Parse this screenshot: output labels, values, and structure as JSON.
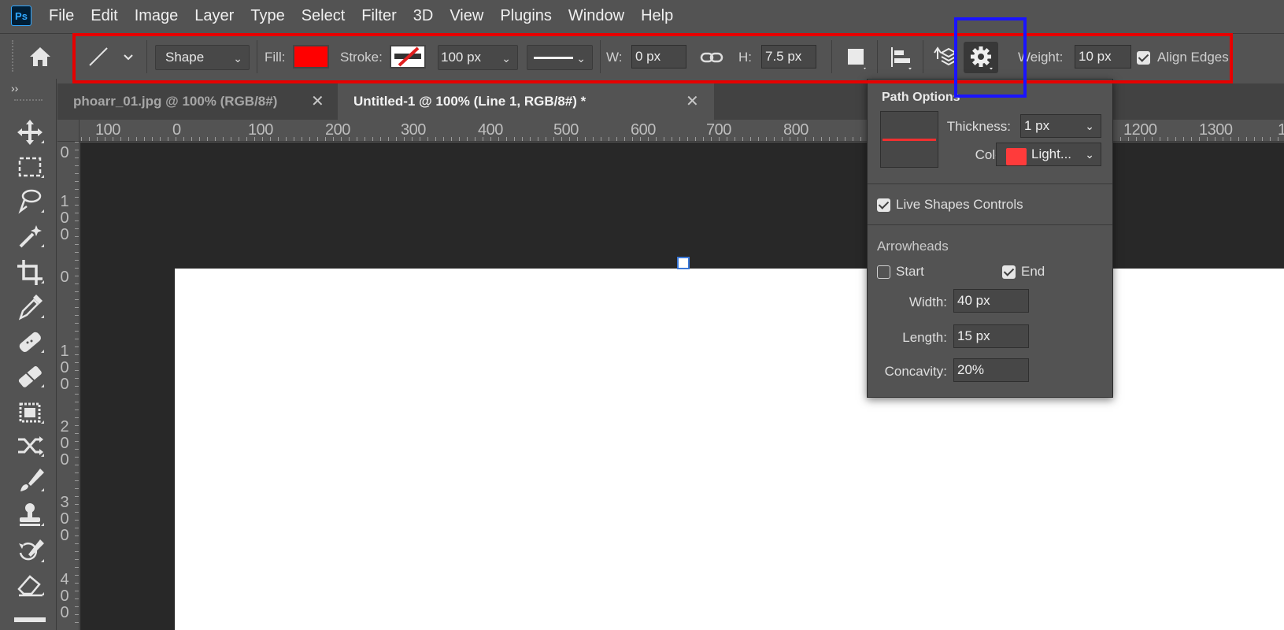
{
  "app": {
    "logo": "Ps",
    "menu": [
      "File",
      "Edit",
      "Image",
      "Layer",
      "Type",
      "Select",
      "Filter",
      "3D",
      "View",
      "Plugins",
      "Window",
      "Help"
    ]
  },
  "options": {
    "mode": "Shape",
    "fill_label": "Fill:",
    "fill_color": "#ff0000",
    "stroke_label": "Stroke:",
    "stroke_width": "100 px",
    "w_label": "W:",
    "w_value": "0 px",
    "h_label": "H:",
    "h_value": "7.5 px",
    "weight_label": "Weight:",
    "weight_value": "10 px",
    "align_edges_label": "Align Edges",
    "align_edges_checked": true,
    "icons": [
      "home-icon",
      "line-tool-icon",
      "link-icon",
      "path-operations-icon",
      "path-alignment-icon",
      "path-arrangement-icon",
      "gear-icon"
    ]
  },
  "annotations": {
    "options_highlight_color": "#e60000",
    "gear_highlight_color": "#1a14ff"
  },
  "tools": [
    "move-tool-icon",
    "marquee-tool-icon",
    "lasso-tool-icon",
    "magic-wand-tool-icon",
    "crop-tool-icon",
    "eyedropper-tool-icon",
    "spot-healing-tool-icon",
    "bandage-tool-icon",
    "content-aware-move-icon",
    "shuffle-tool-icon",
    "brush-tool-icon",
    "clone-stamp-tool-icon",
    "history-brush-tool-icon",
    "eraser-tool-icon"
  ],
  "tabs": [
    {
      "label": "phoarr_01.jpg @ 100% (RGB/8#)",
      "active": false
    },
    {
      "label": "Untitled-1 @ 100% (Line 1, RGB/8#) *",
      "active": true
    }
  ],
  "ruler": {
    "h_ticks": [
      "100",
      "0",
      "100",
      "200",
      "300",
      "400",
      "500",
      "600",
      "700",
      "800",
      "1200",
      "1300",
      "1"
    ],
    "v_ticks": [
      "0",
      "100",
      "0",
      "100",
      "200",
      "300",
      "400"
    ]
  },
  "path_options": {
    "title": "Path Options",
    "thickness_label": "Thickness:",
    "thickness_value": "1 px",
    "color_label": "Color:",
    "color_value": "Light...",
    "color_swatch": "#ff3b3b",
    "live_shapes_label": "Live Shapes Controls",
    "live_shapes_checked": true,
    "arrowheads_label": "Arrowheads",
    "start_label": "Start",
    "start_checked": false,
    "end_label": "End",
    "end_checked": true,
    "width_label": "Width:",
    "width_value": "40 px",
    "length_label": "Length:",
    "length_value": "15 px",
    "concavity_label": "Concavity:",
    "concavity_value": "20%"
  }
}
